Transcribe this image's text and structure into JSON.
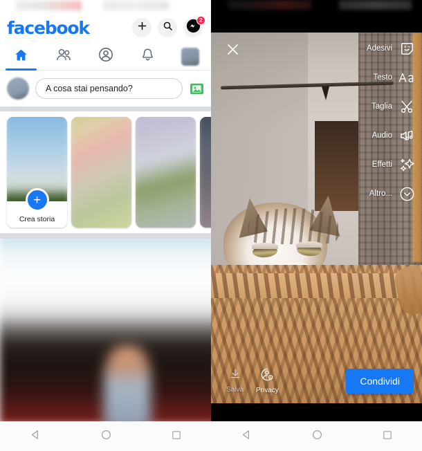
{
  "left_phone": {
    "app_name": "facebook",
    "brand_color": "#1877F2",
    "header": {
      "logo_text": "facebook",
      "actions": [
        {
          "name": "create-button",
          "icon": "plus-icon",
          "label": "+"
        },
        {
          "name": "search-button",
          "icon": "search-icon",
          "label": ""
        },
        {
          "name": "messenger-button",
          "icon": "messenger-icon",
          "label": "",
          "badge": "2"
        }
      ]
    },
    "tabs": [
      {
        "name": "tab-home",
        "icon": "home-icon",
        "active": true
      },
      {
        "name": "tab-friends",
        "icon": "friends-icon",
        "active": false
      },
      {
        "name": "tab-profile",
        "icon": "profile-circle-icon",
        "active": false
      },
      {
        "name": "tab-notifications",
        "icon": "bell-icon",
        "active": false
      },
      {
        "name": "tab-menu",
        "icon": "avatar-menu-icon",
        "active": false
      }
    ],
    "composer": {
      "placeholder": "A cosa stai pensando?",
      "photo_icon": "photo-library-icon"
    },
    "stories": {
      "create": {
        "label": "Crea storia",
        "plus_icon": "plus-icon"
      },
      "items": [
        {
          "name": "story-thumb-1"
        },
        {
          "name": "story-thumb-2"
        },
        {
          "name": "story-thumb-3"
        }
      ]
    },
    "navbar": {
      "back": "back-triangle-icon",
      "home": "home-circle-icon",
      "recents": "recents-square-icon"
    }
  },
  "right_phone": {
    "screen_name": "story-editor",
    "close_label": "close-icon",
    "tools": [
      {
        "label": "Adesivi",
        "icon": "sticker-face-icon",
        "name": "tool-stickers"
      },
      {
        "label": "Testo",
        "icon": "text-aa-icon",
        "name": "tool-text"
      },
      {
        "label": "Taglia",
        "icon": "scissors-icon",
        "name": "tool-crop"
      },
      {
        "label": "Audio",
        "icon": "music-note-speaker-icon",
        "name": "tool-audio"
      },
      {
        "label": "Effetti",
        "icon": "sparkles-icon",
        "name": "tool-effects"
      },
      {
        "label": "Altro...",
        "icon": "chevron-down-circle-icon",
        "name": "tool-more"
      }
    ],
    "bottom_actions": [
      {
        "label": "Salva",
        "icon": "download-icon",
        "name": "save-button",
        "disabled": true
      },
      {
        "label": "Privacy",
        "icon": "privacy-gear-icon",
        "name": "privacy-button",
        "disabled": false
      }
    ],
    "share_button": {
      "label": "Condividi",
      "color": "#1877F2"
    },
    "navbar": {
      "back": "back-triangle-icon",
      "home": "home-circle-icon",
      "recents": "recents-square-icon"
    },
    "media": {
      "description": "cat-in-basket-photo"
    }
  }
}
